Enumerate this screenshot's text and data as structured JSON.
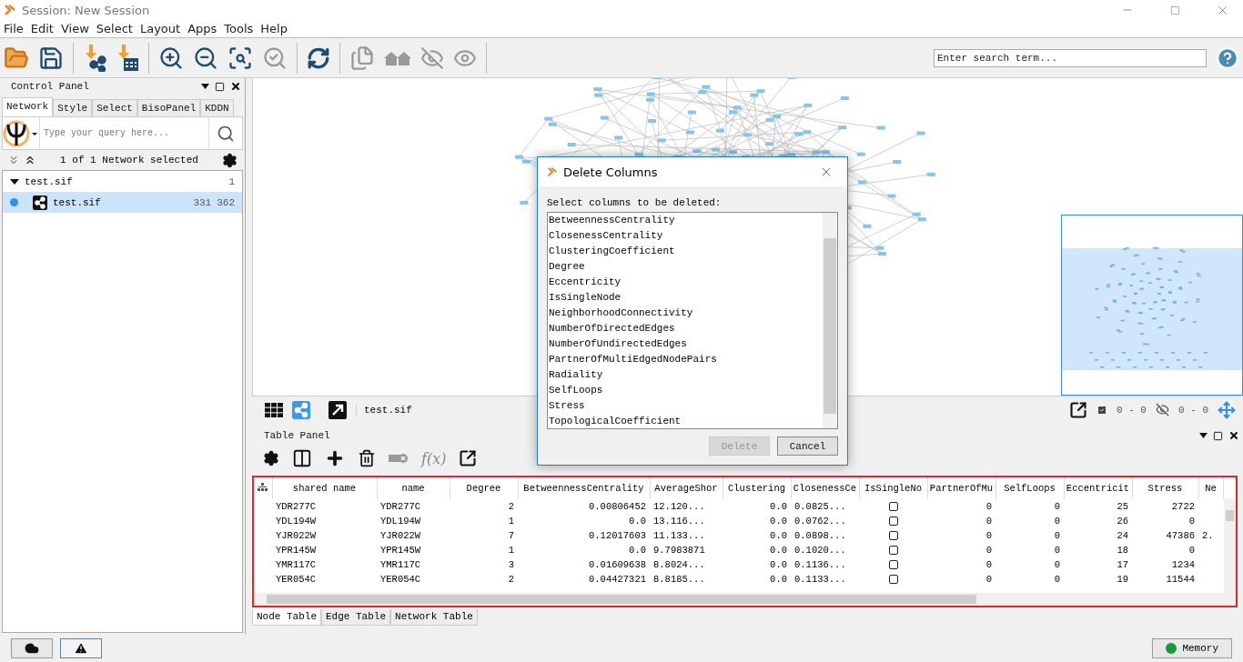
{
  "window": {
    "title": "Session: New Session"
  },
  "menu": [
    "File",
    "Edit",
    "View",
    "Select",
    "Layout",
    "Apps",
    "Tools",
    "Help"
  ],
  "search": {
    "placeholder": "Enter search term..."
  },
  "control_panel": {
    "title": "Control Panel",
    "tabs": [
      {
        "label": "Network",
        "selected": true
      },
      {
        "label": "Style",
        "selected": false
      },
      {
        "label": "Select",
        "selected": false
      },
      {
        "label": "BisoPanel",
        "selected": false
      },
      {
        "label": "KDDN",
        "selected": false
      }
    ],
    "query": {
      "placeholder": "Type your query here..."
    },
    "summary": "1 of 1 Network selected",
    "networks": [
      {
        "name": "test.sif",
        "count": "1",
        "expanded": true,
        "children": [
          {
            "name": "test.sif",
            "nodes": "331",
            "edges": "362",
            "selected": true
          }
        ]
      }
    ]
  },
  "network_view": {
    "title": "test.sif",
    "selected_count": "0 - 0",
    "hidden_count": "0 - 0"
  },
  "table_panel": {
    "title": "Table Panel",
    "function_label": "f(x)",
    "columns": [
      {
        "label": "shared name",
        "kind": "text"
      },
      {
        "label": "name",
        "kind": "text"
      },
      {
        "label": "Degree",
        "kind": "number"
      },
      {
        "label": "BetweennessCentrality",
        "kind": "number"
      },
      {
        "label": "AverageShor",
        "kind": "text"
      },
      {
        "label": "Clustering",
        "kind": "number"
      },
      {
        "label": "ClosenessCe",
        "kind": "text"
      },
      {
        "label": "IsSingleNo",
        "kind": "check"
      },
      {
        "label": "PartnerOfMu",
        "kind": "number"
      },
      {
        "label": "SelfLoops",
        "kind": "number"
      },
      {
        "label": "Eccentricit",
        "kind": "number"
      },
      {
        "label": "Stress",
        "kind": "number"
      },
      {
        "label": "Ne",
        "kind": "text"
      }
    ],
    "rows": [
      {
        "cells": [
          "YDR277C",
          "YDR277C",
          "2",
          "0.00806452",
          "12.120...",
          "0.0",
          "0.0825...",
          false,
          "0",
          "0",
          "25",
          "2722",
          null
        ]
      },
      {
        "cells": [
          "YDL194W",
          "YDL194W",
          "1",
          "0.0",
          "13.116...",
          "0.0",
          "0.0762...",
          false,
          "0",
          "0",
          "26",
          "0",
          null
        ]
      },
      {
        "cells": [
          "YJR022W",
          "YJR022W",
          "7",
          "0.12017603",
          "11.133...",
          "0.0",
          "0.0898...",
          false,
          "0",
          "0",
          "24",
          "47386",
          "2."
        ]
      },
      {
        "cells": [
          "YPR145W",
          "YPR145W",
          "1",
          "0.0",
          "9.7983871",
          "0.0",
          "0.1020...",
          false,
          "0",
          "0",
          "18",
          "0",
          null
        ]
      },
      {
        "cells": [
          "YMR117C",
          "YMR117C",
          "3",
          "0.01609638",
          "8.8024...",
          "0.0",
          "0.1136...",
          false,
          "0",
          "0",
          "17",
          "1234",
          null
        ]
      },
      {
        "cells": [
          "YER054C",
          "YER054C",
          "2",
          "0.04427321",
          "8.8185...",
          "0.0",
          "0.1133...",
          false,
          "0",
          "0",
          "19",
          "11544",
          null
        ]
      }
    ],
    "tabs": [
      {
        "label": "Node Table",
        "selected": true
      },
      {
        "label": "Edge Table",
        "selected": false
      },
      {
        "label": "Network Table",
        "selected": false
      }
    ]
  },
  "dialog": {
    "title": "Delete Columns",
    "prompt": "Select columns to be deleted:",
    "items": [
      "BetweennessCentrality",
      "ClosenessCentrality",
      "ClusteringCoefficient",
      "Degree",
      "Eccentricity",
      "IsSingleNode",
      "NeighborhoodConnectivity",
      "NumberOfDirectedEdges",
      "NumberOfUndirectedEdges",
      "PartnerOfMultiEdgedNodePairs",
      "Radiality",
      "SelfLoops",
      "Stress",
      "TopologicalCoefficient"
    ],
    "buttons": [
      {
        "label": "Delete",
        "disabled": true
      },
      {
        "label": "Cancel",
        "disabled": false
      }
    ]
  },
  "status_bar": {
    "memory": "Memory"
  }
}
